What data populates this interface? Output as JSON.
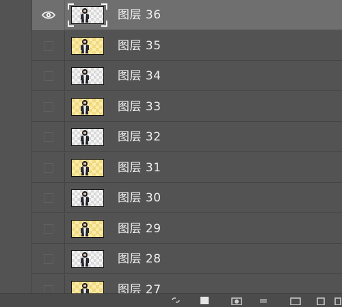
{
  "panel": {
    "title": ""
  },
  "layers": [
    {
      "name": "图层 36",
      "visible": true,
      "selected": true,
      "thumb": "white"
    },
    {
      "name": "图层 35",
      "visible": false,
      "selected": false,
      "thumb": "yellow"
    },
    {
      "name": "图层 34",
      "visible": false,
      "selected": false,
      "thumb": "white"
    },
    {
      "name": "图层 33",
      "visible": false,
      "selected": false,
      "thumb": "yellow"
    },
    {
      "name": "图层 32",
      "visible": false,
      "selected": false,
      "thumb": "white"
    },
    {
      "name": "图层 31",
      "visible": false,
      "selected": false,
      "thumb": "yellow"
    },
    {
      "name": "图层 30",
      "visible": false,
      "selected": false,
      "thumb": "white"
    },
    {
      "name": "图层 29",
      "visible": false,
      "selected": false,
      "thumb": "yellow"
    },
    {
      "name": "图层 28",
      "visible": false,
      "selected": false,
      "thumb": "white"
    },
    {
      "name": "图层 27",
      "visible": false,
      "selected": false,
      "thumb": "yellow"
    }
  ],
  "footer": {
    "icons": [
      "link-layers-icon",
      "fx-icon",
      "add-mask-icon",
      "adjustment-layer-icon",
      "group-icon",
      "new-layer-icon",
      "delete-icon"
    ]
  },
  "colors": {
    "panel_bg": "#535353",
    "selected_bg": "#6f6f6f",
    "text": "#f0f0f0",
    "thumb_yellow": "#f0d982"
  }
}
